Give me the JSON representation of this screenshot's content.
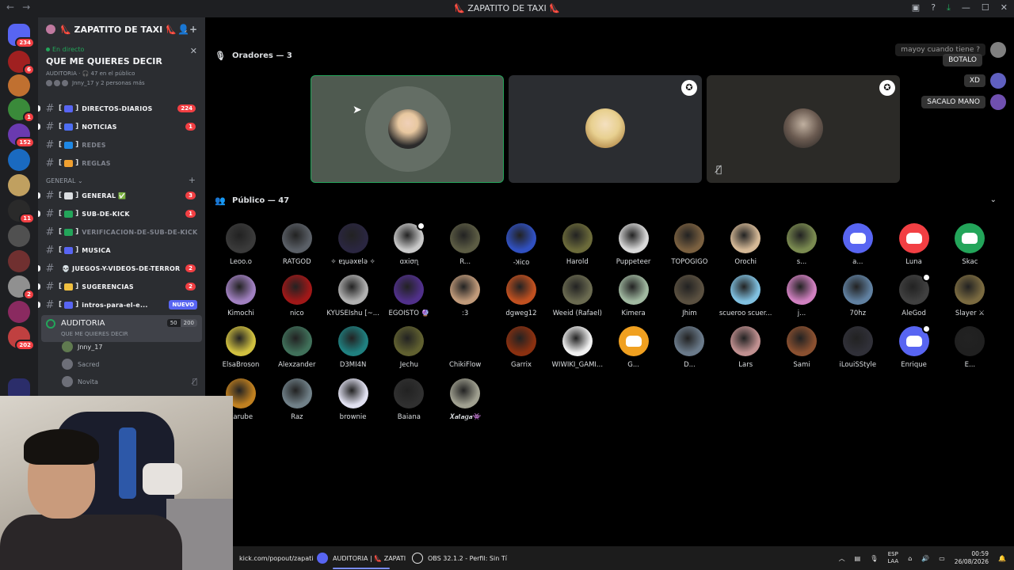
{
  "window": {
    "title": "👠 ZAPATITO DE TAXI 👠"
  },
  "server": {
    "name": "👠 ZAPATITO DE TAXI 👠"
  },
  "rail_badges": [
    "234",
    "6",
    "",
    "1",
    "152",
    "",
    "",
    "11",
    "",
    "",
    "2",
    "",
    "202"
  ],
  "live": {
    "tag": "En directo",
    "title": "QUE ME QUIERES DECIR",
    "meta": "AUDITORIA · 🎧 47 en el público",
    "people": "Jnny_17 y 2 personas más"
  },
  "channels": [
    {
      "name": "DIRECTOS-DIARIOS",
      "count": "224",
      "color": "#5865f2"
    },
    {
      "name": "NOTICIAS",
      "count": "1",
      "color": "#4e6ef2"
    },
    {
      "name": "REDES",
      "count": "",
      "color": "#1e88e5",
      "muted": true
    },
    {
      "name": "REGLAS",
      "count": "",
      "color": "#f0a030",
      "muted": true
    }
  ],
  "category": {
    "label": "GENERAL"
  },
  "channels2": [
    {
      "name": "GENERAL ✅",
      "count": "3",
      "color": "#dbdee1"
    },
    {
      "name": "SUB-DE-KICK",
      "count": "1",
      "color": "#23a55a"
    },
    {
      "name": "VERIFICACION-DE-SUB-DE-KICK",
      "count": "",
      "color": "#23a55a",
      "muted": true
    },
    {
      "name": "MUSICA",
      "count": "",
      "color": "#5865f2"
    },
    {
      "name": "💀 JUEGOS-Y-VIDEOS-DE-TERROR",
      "count": "2",
      "color": ""
    },
    {
      "name": "SUGERENCIAS",
      "count": "2",
      "color": "#f0c040"
    },
    {
      "name": "intros-para-el-e...",
      "count": "",
      "color": "#5865f2",
      "nuevo": "NUEVO"
    }
  ],
  "stage": {
    "name": "AUDITORIA",
    "topic": "QUE ME QUIERES DECIR",
    "count_a": "50",
    "count_b": "200"
  },
  "voice_users": [
    "Jnny_17",
    "Sacred",
    "Novita"
  ],
  "speakers": {
    "header": "Oradores — 3"
  },
  "audience": {
    "header": "Público — 47",
    "members": [
      {
        "name": "Leoo.o",
        "color": "#3a3a3a"
      },
      {
        "name": "RATGOD",
        "color": "#5a5f66"
      },
      {
        "name": "✧ ɐʇuəxɐlə ✧",
        "color": "#2a2640"
      },
      {
        "name": "ɑxiσɳ",
        "color": "#c8c8c8",
        "mod": true
      },
      {
        "name": "R...",
        "color": "#5c5c44"
      },
      {
        "name": "-Ʞico",
        "color": "#3050c0"
      },
      {
        "name": "Harold",
        "color": "#6b6a3a"
      },
      {
        "name": "Puppeteer",
        "color": "#d8d8d8"
      },
      {
        "name": "TOPOGIGO",
        "color": "#7a6040"
      },
      {
        "name": "Orochi",
        "color": "#d4b896"
      },
      {
        "name": "s...",
        "color": "#7a8a50"
      },
      {
        "name": "a...",
        "color": "",
        "discord": "#5865f2"
      },
      {
        "name": "Luna",
        "color": "",
        "discord": "#f23f43"
      },
      {
        "name": "Skac",
        "color": "",
        "discord": "#23a55a"
      },
      {
        "name": "Kimochi",
        "color": "#a080c0"
      },
      {
        "name": "nico",
        "color": "#a01818"
      },
      {
        "name": "KYUSEIshu [~...",
        "color": "#b0b0b0"
      },
      {
        "name": "EGOISTO 🔮",
        "color": "#50308a"
      },
      {
        "name": ":3",
        "color": "#c09a7a"
      },
      {
        "name": "dgweg12",
        "color": "#c05020"
      },
      {
        "name": "Weeid (Rafael)",
        "color": "#6a6a50"
      },
      {
        "name": "Kimera",
        "color": "#a0b8a0"
      },
      {
        "name": "Jhim",
        "color": "#5a5040"
      },
      {
        "name": "scueroo scuer...",
        "color": "#80c0e0"
      },
      {
        "name": "j...",
        "color": "#d080c0"
      },
      {
        "name": "70hz",
        "color": "#6080a0"
      },
      {
        "name": "AleGod",
        "color": "#404040",
        "mod": true
      },
      {
        "name": "Slayer ⚔",
        "color": "#7a6a40"
      },
      {
        "name": "ElsaBroson",
        "color": "#d0c040"
      },
      {
        "name": "Alexzander",
        "color": "#40705a"
      },
      {
        "name": "D3MI4N",
        "color": "#208080"
      },
      {
        "name": "Jechu",
        "color": "#606030"
      },
      {
        "name": "ChikiFlow",
        "color": "#000000"
      },
      {
        "name": "Garrix",
        "color": "#8a3010"
      },
      {
        "name": "WIWIKI_GAMI...",
        "color": "#f0f0f0"
      },
      {
        "name": "G...",
        "color": "",
        "discord": "#f0a020"
      },
      {
        "name": "D...",
        "color": "#6a7a8a"
      },
      {
        "name": "Lars",
        "color": "#c09090"
      },
      {
        "name": "Sami",
        "color": "#8a5030"
      },
      {
        "name": "iLouiSStyle",
        "color": "#303038"
      },
      {
        "name": "Enrique",
        "color": "",
        "discord": "#5865f2",
        "mod": true
      },
      {
        "name": "E...",
        "color": "#202020"
      },
      {
        "name": "Karube",
        "color": "#c08020"
      },
      {
        "name": "Raz",
        "color": "#708088"
      },
      {
        "name": "brownie",
        "color": "#e0e0f0"
      },
      {
        "name": "Baiana",
        "color": "#303030"
      },
      {
        "name": "𝑿𝒂𝒕𝒂𝒈𝒂👾",
        "color": "#a0a090"
      }
    ]
  },
  "chat_overlay": [
    {
      "text": "mayoy cuando tiene ?",
      "faded": true
    },
    {
      "text": "BOTALO",
      "faded": false
    },
    {
      "text": "XD",
      "faded": false
    },
    {
      "text": "SACALO MANO",
      "faded": false
    }
  ],
  "taskbar": {
    "browser_url": "kick.com/popout/zapati",
    "discord_item": "AUDITORIA | 👠 ZAPATI",
    "obs_item": "OBS 32.1.2 - Perfil: Sin Tí",
    "lang_1": "ESP",
    "lang_2": "LAA",
    "time": "00:59",
    "date": "26/08/2026"
  }
}
